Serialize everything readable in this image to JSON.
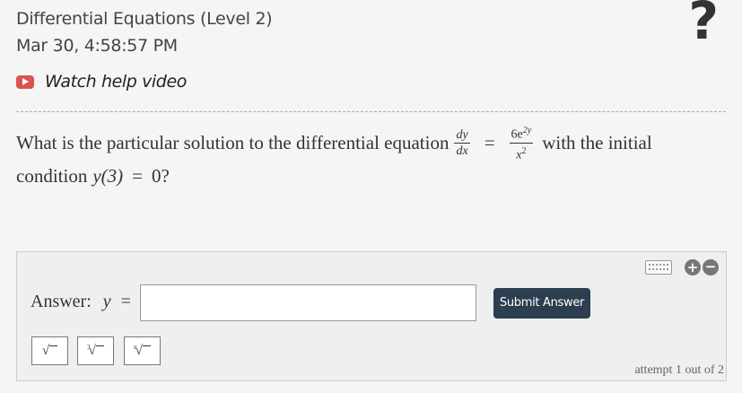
{
  "header": {
    "title": "Differential Equations (Level 2)",
    "datetime": "Mar 30, 4:58:57 PM",
    "help_icon": "?",
    "video_link": "Watch help video"
  },
  "question": {
    "text_before": "What is the particular solution to the differential equation",
    "frac1_num": "dy",
    "frac1_den": "dx",
    "equals": "=",
    "frac2_num_coef": "6e",
    "frac2_num_exp": "2y",
    "frac2_den_base": "x",
    "frac2_den_exp": "2",
    "text_after": "with the initial",
    "line2_text": "condition",
    "condition_lhs": "y(3)",
    "condition_equals": "=",
    "condition_rhs": "0?"
  },
  "answer": {
    "label": "Answer:",
    "variable": "y",
    "equals": "=",
    "input_value": "",
    "submit_label": "Submit Answer",
    "tools": [
      {
        "name": "sqrt",
        "symbol": "√"
      },
      {
        "name": "cube-root",
        "index": "3",
        "symbol": "√"
      },
      {
        "name": "nth-root",
        "index": "n",
        "symbol": "√"
      }
    ],
    "zoom_in": "+",
    "zoom_out": "−",
    "attempt_text": "attempt 1 out of 2"
  },
  "icons": {
    "video": "youtube-play-icon",
    "keyboard": "keyboard-icon",
    "zoom_in": "zoom-in-icon",
    "zoom_out": "zoom-out-icon"
  },
  "colors": {
    "submit_bg": "#2c3e50",
    "video_icon": "#d9534f"
  }
}
